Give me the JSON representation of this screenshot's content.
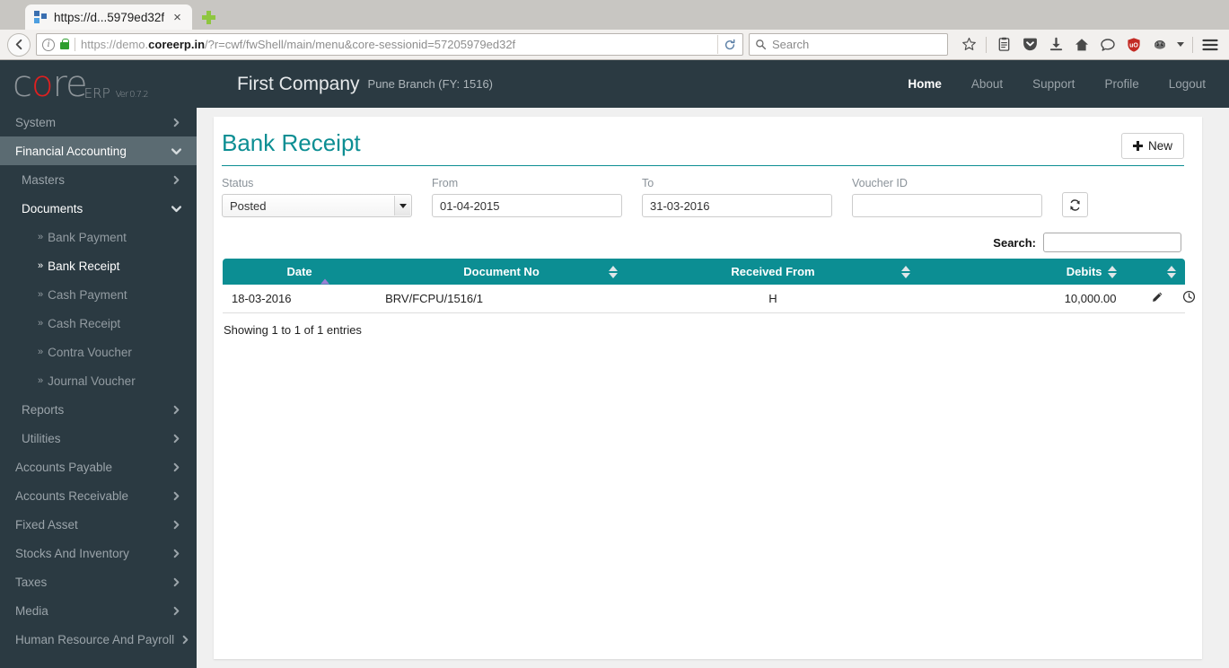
{
  "browser": {
    "tab": {
      "title": "https://d...5979ed32f",
      "close_label": "×",
      "favicon": "grid-favicon"
    },
    "new_tab_label": "+",
    "url": {
      "scheme": "https://demo.",
      "domain": "coreerp.in",
      "path": "/?r=cwf/fwShell/main/menu&core-sessionid=57205979ed32f"
    },
    "search_placeholder": "Search",
    "icons": [
      "back-arrow-icon",
      "page-info-icon",
      "lock-icon",
      "reload-icon",
      "search-icon",
      "bookmark-star-icon",
      "reader-list-icon",
      "pocket-icon",
      "download-icon",
      "home-icon",
      "chat-bubble-icon",
      "ublock-origin-icon",
      "privacy-badger-icon",
      "dropdown-caret-icon",
      "hamburger-menu-icon"
    ]
  },
  "app": {
    "logo": {
      "c": "c",
      "o": "o",
      "re": "re",
      "erp": "ERP",
      "version": "Ver 0.7.2"
    },
    "company": "First Company",
    "branch": "Pune Branch (FY: 1516)",
    "topnav": [
      {
        "label": "Home",
        "active": true
      },
      {
        "label": "About",
        "active": false
      },
      {
        "label": "Support",
        "active": false
      },
      {
        "label": "Profile",
        "active": false
      },
      {
        "label": "Logout",
        "active": false
      }
    ]
  },
  "sidebar": {
    "items": [
      {
        "label": "System",
        "level": 0,
        "state": "collapsed"
      },
      {
        "label": "Financial Accounting",
        "level": 0,
        "state": "expanded-active"
      },
      {
        "label": "Masters",
        "level": 1,
        "state": "collapsed"
      },
      {
        "label": "Documents",
        "level": 1,
        "state": "expanded"
      }
    ],
    "documents": [
      {
        "label": "Bank Payment",
        "active": false
      },
      {
        "label": "Bank Receipt",
        "active": true
      },
      {
        "label": "Cash Payment",
        "active": false
      },
      {
        "label": "Cash Receipt",
        "active": false
      },
      {
        "label": "Contra Voucher",
        "active": false
      },
      {
        "label": "Journal Voucher",
        "active": false
      }
    ],
    "after": [
      {
        "label": "Reports",
        "level": 1,
        "state": "collapsed"
      },
      {
        "label": "Utilities",
        "level": 1,
        "state": "collapsed"
      },
      {
        "label": "Accounts Payable",
        "level": 0,
        "state": "collapsed"
      },
      {
        "label": "Accounts Receivable",
        "level": 0,
        "state": "collapsed"
      },
      {
        "label": "Fixed Asset",
        "level": 0,
        "state": "collapsed"
      },
      {
        "label": "Stocks And Inventory",
        "level": 0,
        "state": "collapsed"
      },
      {
        "label": "Taxes",
        "level": 0,
        "state": "collapsed"
      },
      {
        "label": "Media",
        "level": 0,
        "state": "collapsed"
      },
      {
        "label": "Human Resource And Payroll",
        "level": 0,
        "state": "collapsed"
      }
    ],
    "bullet": "»"
  },
  "page": {
    "title": "Bank Receipt",
    "new_button": "New",
    "filters": {
      "status_label": "Status",
      "status_value": "Posted",
      "from_label": "From",
      "from_value": "01-04-2015",
      "to_label": "To",
      "to_value": "31-03-2016",
      "voucher_label": "Voucher ID",
      "voucher_value": "",
      "voucher_placeholder": "",
      "refresh_icon": "refresh-icon"
    },
    "search_label": "Search:",
    "search_value": "",
    "table": {
      "columns": [
        {
          "label": "Date",
          "sort": "asc"
        },
        {
          "label": "Document No",
          "sort": "none"
        },
        {
          "label": "Received From",
          "sort": "none"
        },
        {
          "label": "Debits",
          "sort": "none"
        },
        {
          "label": "",
          "sort": "none"
        }
      ],
      "rows": [
        {
          "date": "18-03-2016",
          "document_no": "BRV/FCPU/1516/1",
          "received_from": "H",
          "debits": "10,000.00",
          "actions": [
            "edit-pencil-icon",
            "history-clock-icon"
          ]
        }
      ],
      "footer": "Showing 1 to 1 of 1 entries"
    }
  },
  "colors": {
    "teal": "#0c8e93",
    "sidebar": "#2b3a42",
    "sidebar_active": "#5b6b72",
    "logo_red": "#e02020",
    "sort_active": "#9b7fd4"
  }
}
